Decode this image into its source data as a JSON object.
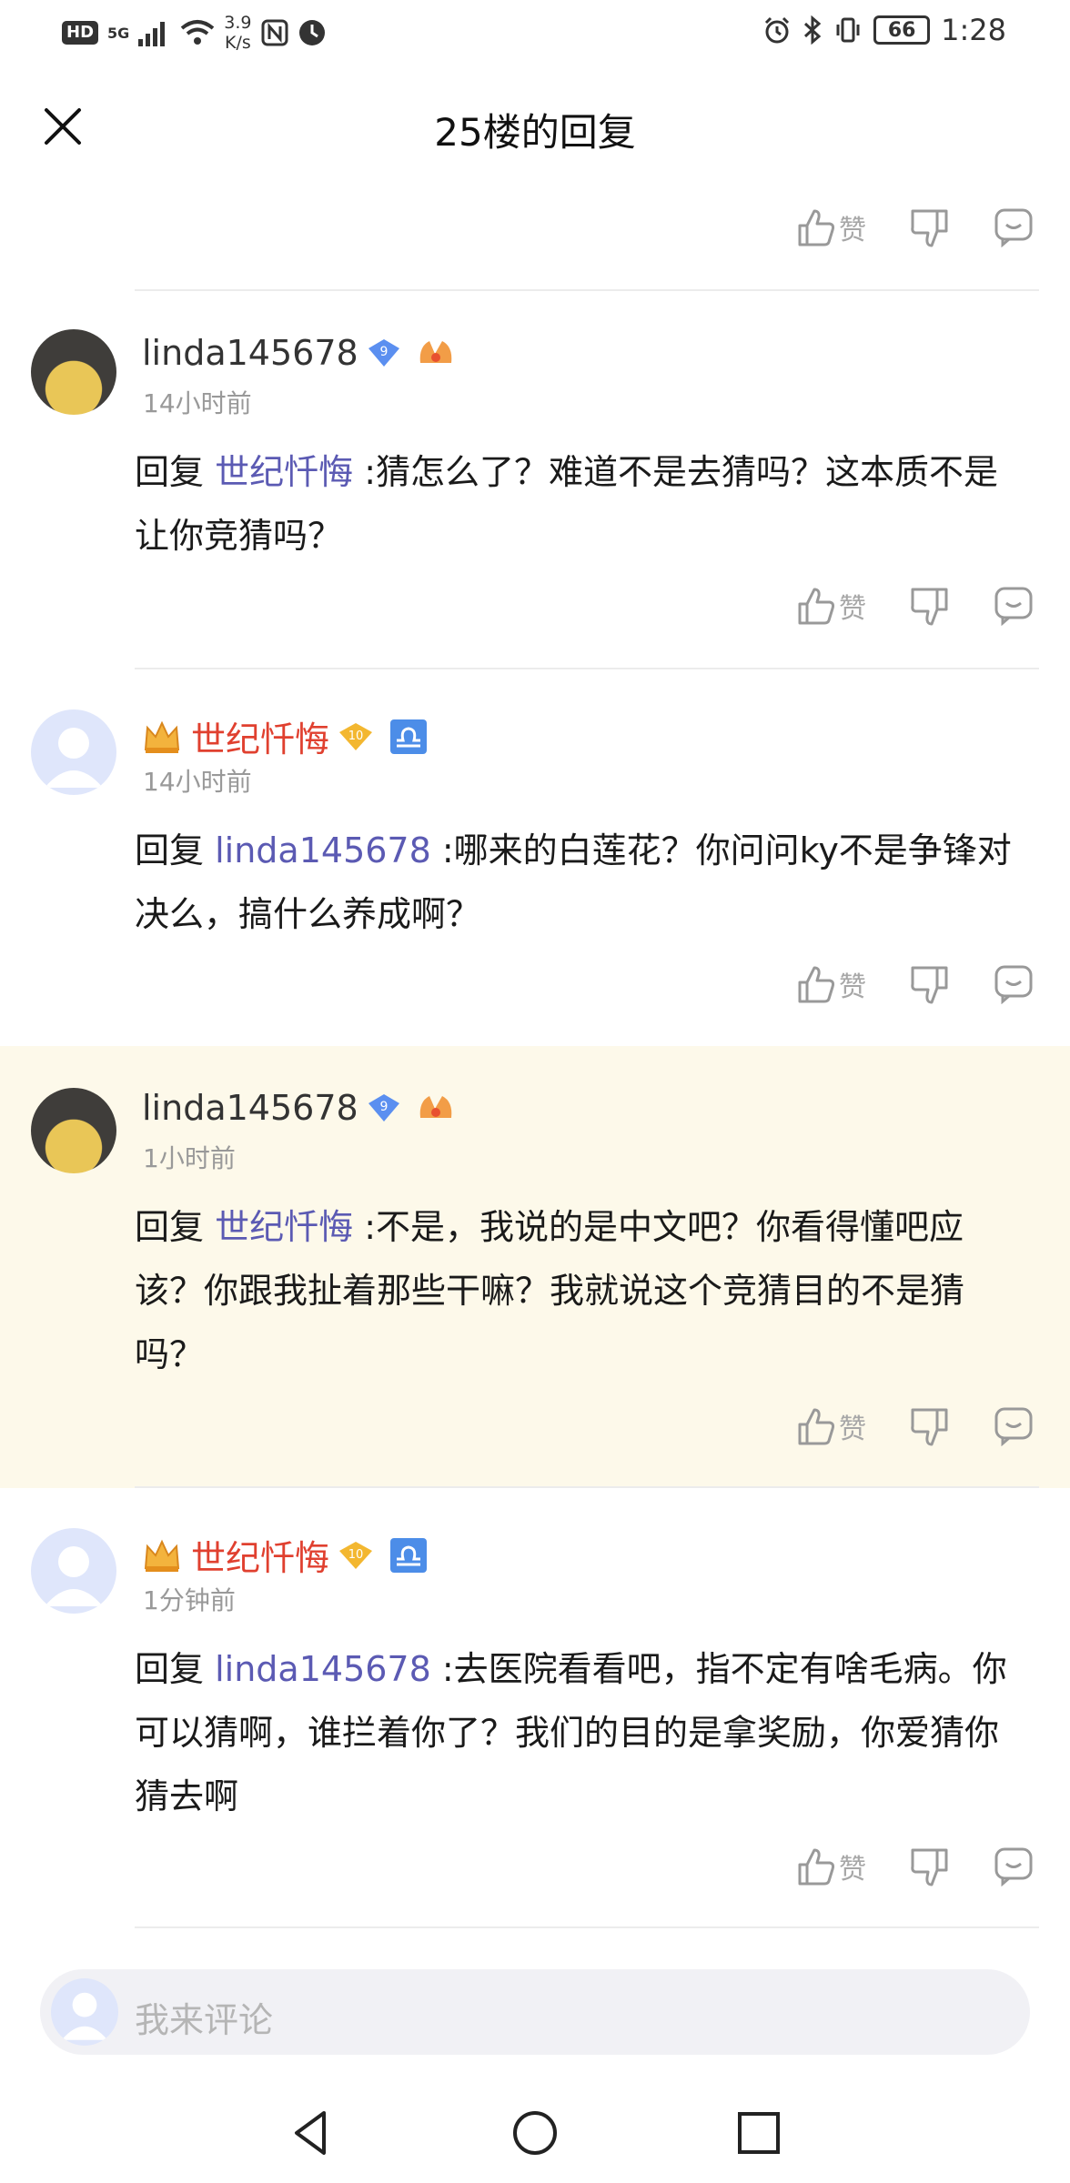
{
  "status_bar": {
    "hd": "HD",
    "signal": "5G",
    "speed_value": "3.9",
    "speed_unit": "K/s",
    "battery": "66",
    "time": "1:28"
  },
  "header": {
    "title": "25楼的回复"
  },
  "actions": {
    "like_label": "赞"
  },
  "comments": [
    {
      "username": "linda145678",
      "level": "9",
      "time": "14小时前",
      "reply_prefix": "回复",
      "mention": "世纪忏悔",
      "text": " :猜怎么了？难道不是去猜吗？这本质不是让你竞猜吗？"
    },
    {
      "username": "世纪忏悔",
      "level": "10",
      "time": "14小时前",
      "reply_prefix": "回复",
      "mention": "linda145678",
      "text": " :哪来的白莲花？你问问ky不是争锋对决么，搞什么养成啊？"
    },
    {
      "username": "linda145678",
      "level": "9",
      "time": "1小时前",
      "reply_prefix": "回复",
      "mention": "世纪忏悔",
      "text": " :不是，我说的是中文吧？你看得懂吧应该？你跟我扯着那些干嘛？我就说这个竞猜目的不是猜吗？"
    },
    {
      "username": "世纪忏悔",
      "level": "10",
      "time": "1分钟前",
      "reply_prefix": "回复",
      "mention": "linda145678",
      "text": " :去医院看看吧，指不定有啥毛病。你可以猜啊，谁拦着你了？我们的目的是拿奖励，你爱猜你猜去啊"
    }
  ],
  "comment_input": {
    "placeholder": "我来评论"
  },
  "colors": {
    "mention": "#5b5ab3",
    "vip_name": "#e0402f",
    "highlight_bg": "#fdf9ea"
  }
}
